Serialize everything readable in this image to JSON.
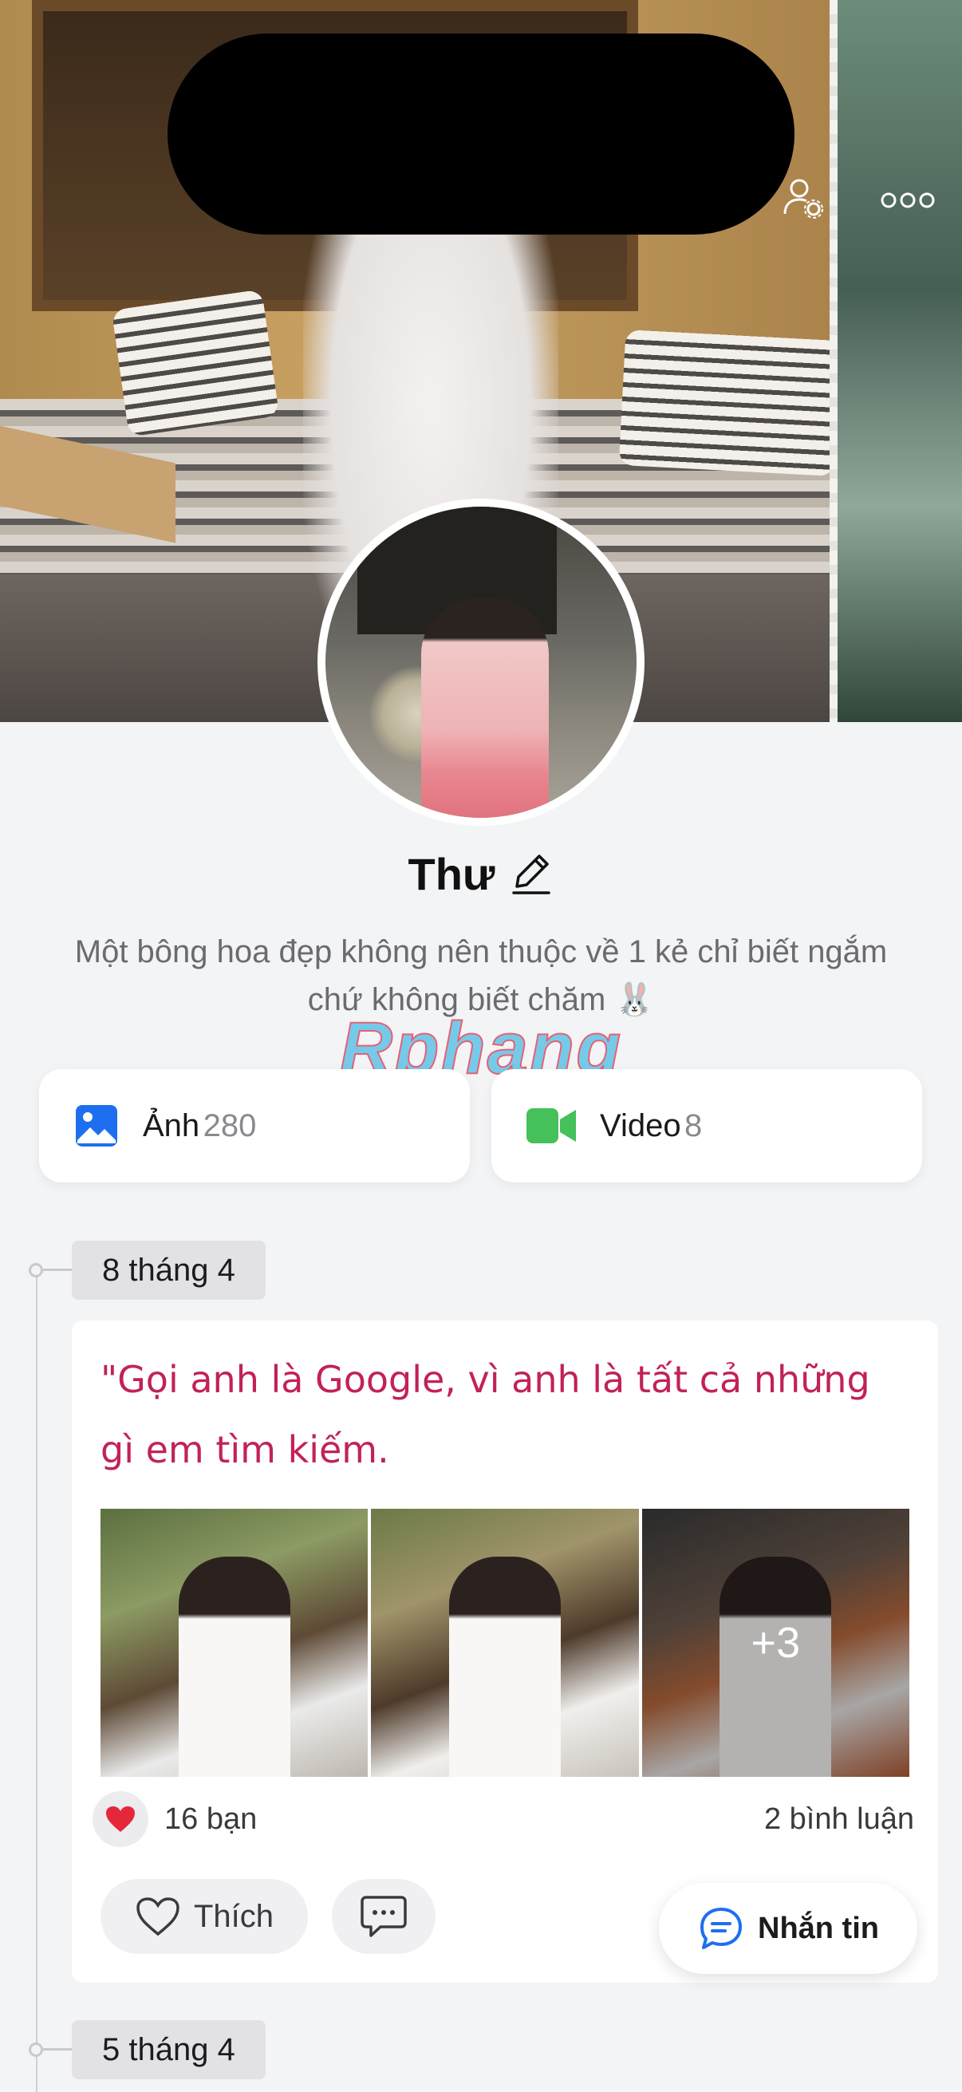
{
  "profile": {
    "name": "Thư",
    "bio": "Một bông hoa đẹp không nên thuộc về 1 kẻ chỉ biết ngắm chứ không biết chăm 🐰"
  },
  "watermark": "Rphang",
  "media": {
    "photos_label": "Ảnh",
    "photos_count": "280",
    "videos_label": "Video",
    "videos_count": "8"
  },
  "timeline": [
    {
      "date": "8 tháng 4",
      "post": {
        "text": "\"Gọi anh là Google, vì anh là tất cả những gì em tìm kiếm.",
        "more_photos": "+3",
        "likes": "16 bạn",
        "comments": "2 bình luận",
        "like_button": "Thích"
      }
    },
    {
      "date": "5 tháng 4"
    }
  ],
  "fab": {
    "label": "Nhắn tin"
  },
  "colors": {
    "accent_blue": "#1e6ff0",
    "video_green": "#45c05a",
    "post_text": "#c2215a",
    "heart": "#e5273a"
  },
  "icons": [
    "friend-settings-icon",
    "more-icon",
    "edit-pencil-icon",
    "photo-icon",
    "video-camera-icon",
    "heart-icon",
    "comment-icon",
    "chat-bubble-icon"
  ]
}
